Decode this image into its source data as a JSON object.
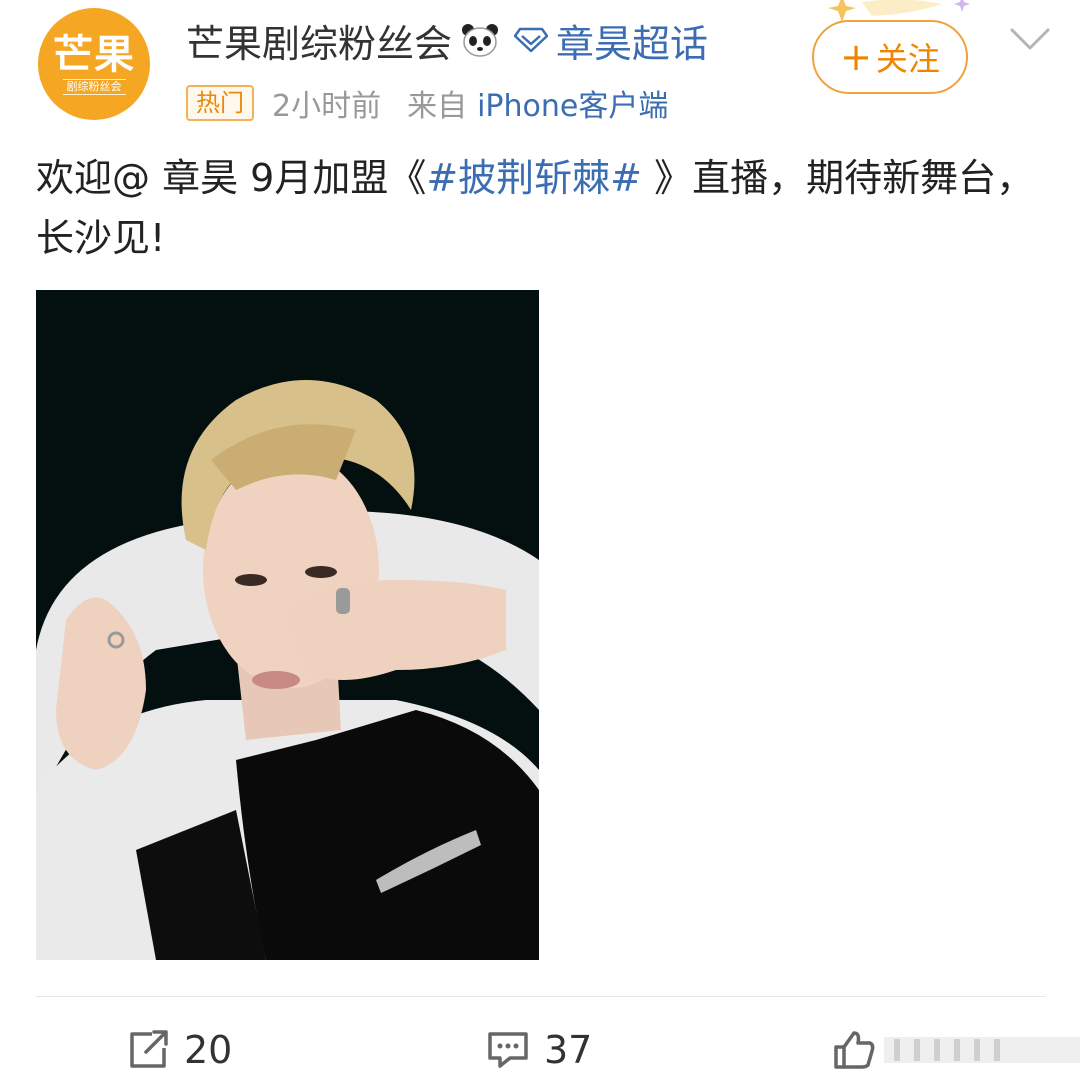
{
  "header": {
    "avatar_main": "芒果",
    "avatar_sub": "剧综粉丝会",
    "username": "芒果剧综粉丝会",
    "supertopic": "章昊超话",
    "hot_badge": "热门",
    "time": "2小时前",
    "from_label": "来自",
    "device": "iPhone客户端",
    "follow_plus": "+",
    "follow_label": "关注"
  },
  "post": {
    "text_1": "欢迎@ 章昊 9月加盟《",
    "topic": "#披荆斩棘#",
    "text_2": " 》直播，期待新舞台，长沙见!"
  },
  "actions": {
    "repost_count": "20",
    "comment_count": "37"
  },
  "colors": {
    "accent_orange": "#f08300",
    "link_blue": "#3b6db3",
    "avatar_bg": "#f5a623"
  }
}
